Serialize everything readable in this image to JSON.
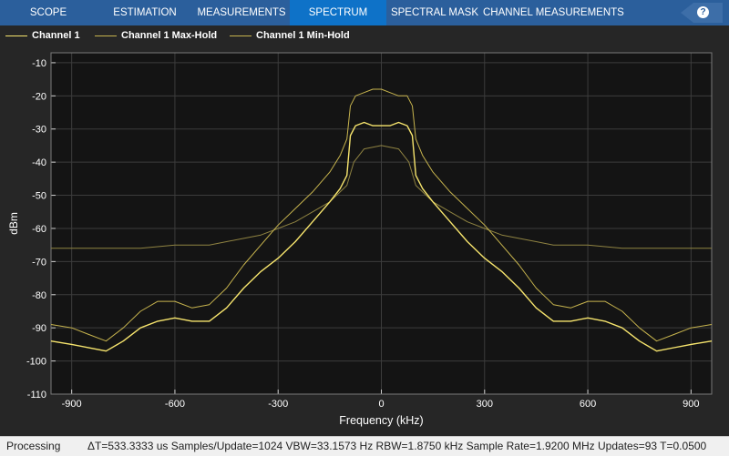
{
  "toolstrip": {
    "tabs": [
      {
        "label": "SCOPE",
        "active": false
      },
      {
        "label": "ESTIMATION",
        "active": false
      },
      {
        "label": "MEASUREMENTS",
        "active": false
      },
      {
        "label": "SPECTRUM",
        "active": true
      },
      {
        "label": "SPECTRAL MASK",
        "active": false
      },
      {
        "label": "CHANNEL MEASUREMENTS",
        "active": false
      }
    ],
    "help_label": "?"
  },
  "colors": {
    "toolstrip_bg": "#2b5f9c",
    "active_tab": "#0e72c8",
    "plot_bg": "#141414",
    "figure_bg": "#262626",
    "channel": "#f7e56d",
    "maxhold": "#c7b44e",
    "minhold": "#8f8342"
  },
  "legend": [
    {
      "label": "Channel 1",
      "icon": "line-icon"
    },
    {
      "label": "Channel 1 Max-Hold",
      "icon": "line-icon"
    },
    {
      "label": "Channel 1 Min-Hold",
      "icon": "line-icon"
    }
  ],
  "chart_data": {
    "type": "line",
    "xlabel": "Frequency (kHz)",
    "ylabel": "dBm",
    "xlim": [
      -960,
      960
    ],
    "ylim": [
      -110,
      -7
    ],
    "x_ticks": [
      -900,
      -600,
      -300,
      0,
      300,
      600,
      900
    ],
    "y_ticks": [
      -10,
      -20,
      -30,
      -40,
      -50,
      -60,
      -70,
      -80,
      -90,
      -100,
      -110
    ],
    "grid": true,
    "legend_position": "top-left",
    "series": [
      {
        "name": "Channel 1",
        "x": [
          -960,
          -900,
          -850,
          -800,
          -750,
          -700,
          -650,
          -600,
          -550,
          -500,
          -450,
          -400,
          -350,
          -300,
          -250,
          -200,
          -150,
          -120,
          -100,
          -90,
          -75,
          -50,
          -25,
          0,
          25,
          50,
          75,
          90,
          100,
          120,
          150,
          200,
          250,
          300,
          350,
          400,
          450,
          500,
          550,
          600,
          650,
          700,
          750,
          800,
          850,
          900,
          960
        ],
        "y": [
          -94,
          -95,
          -96,
          -97,
          -94,
          -90,
          -88,
          -87,
          -88,
          -88,
          -84,
          -78,
          -73,
          -69,
          -64,
          -58,
          -52,
          -48,
          -44,
          -32,
          -29,
          -28,
          -29,
          -29,
          -29,
          -28,
          -29,
          -32,
          -44,
          -48,
          -52,
          -58,
          -64,
          -69,
          -73,
          -78,
          -84,
          -88,
          -88,
          -87,
          -88,
          -90,
          -94,
          -97,
          -96,
          -95,
          -94
        ]
      },
      {
        "name": "Channel 1 Max-Hold",
        "x": [
          -960,
          -900,
          -850,
          -800,
          -750,
          -700,
          -650,
          -600,
          -550,
          -500,
          -450,
          -400,
          -350,
          -300,
          -250,
          -200,
          -150,
          -120,
          -100,
          -90,
          -75,
          -50,
          -25,
          0,
          25,
          50,
          75,
          90,
          100,
          120,
          150,
          200,
          250,
          300,
          350,
          400,
          450,
          500,
          550,
          600,
          650,
          700,
          750,
          800,
          850,
          900,
          960
        ],
        "y": [
          -89,
          -90,
          -92,
          -94,
          -90,
          -85,
          -82,
          -82,
          -84,
          -83,
          -78,
          -71,
          -65,
          -59,
          -54,
          -49,
          -43,
          -38,
          -33,
          -23,
          -20,
          -19,
          -18,
          -18,
          -19,
          -20,
          -20,
          -23,
          -33,
          -38,
          -43,
          -49,
          -54,
          -59,
          -65,
          -71,
          -78,
          -83,
          -84,
          -82,
          -82,
          -85,
          -90,
          -94,
          -92,
          -90,
          -89
        ]
      },
      {
        "name": "Channel 1 Min-Hold",
        "x": [
          -960,
          -900,
          -800,
          -700,
          -600,
          -500,
          -450,
          -400,
          -350,
          -300,
          -250,
          -200,
          -150,
          -120,
          -100,
          -80,
          -50,
          0,
          50,
          80,
          100,
          120,
          150,
          200,
          250,
          300,
          350,
          400,
          450,
          500,
          600,
          700,
          800,
          900,
          960
        ],
        "y": [
          -66,
          -66,
          -66,
          -66,
          -65,
          -65,
          -64,
          -63,
          -62,
          -60,
          -58,
          -55,
          -52,
          -49,
          -47,
          -40,
          -36,
          -35,
          -36,
          -40,
          -47,
          -49,
          -52,
          -55,
          -58,
          -60,
          -62,
          -63,
          -64,
          -65,
          -65,
          -66,
          -66,
          -66,
          -66
        ]
      }
    ]
  },
  "status": {
    "state": "Processing",
    "metrics": "ΔT=533.3333 us  Samples/Update=1024  VBW=33.1573 Hz  RBW=1.8750 kHz  Sample Rate=1.9200 MHz  Updates=93  T=0.0500"
  }
}
